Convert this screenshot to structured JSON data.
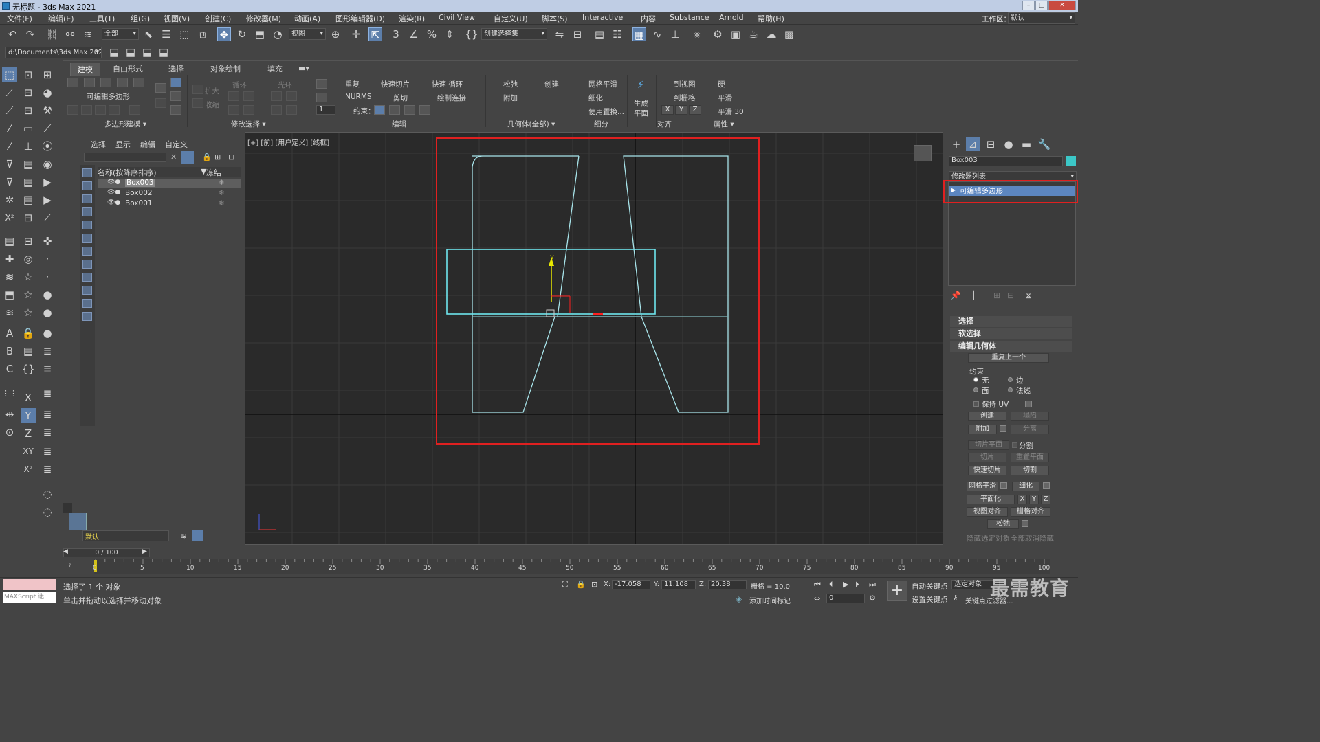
{
  "window": {
    "title": "无标题 - 3ds Max 2021",
    "controls": [
      "–",
      "□",
      "✕"
    ]
  },
  "menu": {
    "items": [
      "文件(F)",
      "编辑(E)",
      "工具(T)",
      "组(G)",
      "视图(V)",
      "创建(C)",
      "修改器(M)",
      "动画(A)",
      "图形编辑器(D)",
      "渲染(R)",
      "Civil View",
      "自定义(U)",
      "脚本(S)",
      "Interactive",
      "内容",
      "Substance",
      "Arnold",
      "帮助(H)"
    ],
    "workspace_label": "工作区：",
    "workspace_value": "默认"
  },
  "toolbar": {
    "selection_filter": "全部",
    "reference_coord": "视图",
    "named_selection": "创建选择集",
    "project_path": "d:\\Documents\\3ds Max 2021"
  },
  "ribbon": {
    "tabs": [
      "建模",
      "自由形式",
      "选择",
      "对象绘制",
      "填充"
    ],
    "panel_polymodeling_label": "可编辑多边形",
    "expand": "扩大",
    "shrink": "收缩",
    "loop": "循环",
    "ring": "光环",
    "repeat": "重复",
    "quickslice": "快速切片",
    "quickloop": "快速 循环",
    "nurms": "NURMS",
    "cut": "剪切",
    "paintconnect": "绘制连接",
    "constraints": "约束：",
    "relax": "松弛",
    "create": "创建",
    "attach": "附加",
    "meshsmooth": "网格平滑",
    "tessellate": "细化",
    "use_displace": "使用置换...",
    "generate": "生成",
    "plane": "平面",
    "to_view": "到视图",
    "to_grid": "到栅格",
    "hard": "硬",
    "smooth": "平滑",
    "smooth30": "平滑 30",
    "spin_value": "1",
    "footers": [
      "多边形建模 ▾",
      "修改选择 ▾",
      "编辑",
      "几何体(全部) ▾",
      "细分",
      "对齐",
      "属性 ▾"
    ]
  },
  "scene_explorer": {
    "tabs": [
      "选择",
      "显示",
      "编辑",
      "自定义"
    ],
    "col_name": "名称(按降序排序)",
    "col_freeze": "冻结",
    "objects": [
      {
        "name": "Box003",
        "selected": true
      },
      {
        "name": "Box002",
        "selected": false
      },
      {
        "name": "Box001",
        "selected": false
      }
    ],
    "layer": "默认"
  },
  "viewport": {
    "label": "[+] [前] [用户定义] [线框]",
    "gizmo_y": "y"
  },
  "command_panel": {
    "object_name": "Box003",
    "modifier_list": "修改器列表",
    "stack_item": "可编辑多边形",
    "rollouts": [
      "选择",
      "软选择",
      "编辑几何体"
    ],
    "repeat_last": "重复上一个",
    "constraints_label": "约束",
    "c_none": "无",
    "c_edge": "边",
    "c_face": "面",
    "c_normal": "法线",
    "preserve_uv": "保持 UV",
    "create": "创建",
    "collapse": "塌陷",
    "attach": "附加",
    "detach": "分离",
    "slice_plane": "切片平面",
    "split": "分割",
    "slice": "切片",
    "reset_plane": "重置平面",
    "quickslice": "快速切片",
    "cut": "切割",
    "meshsmooth": "网格平滑",
    "tessellate": "细化",
    "make_planar": "平面化",
    "xyz": [
      "X",
      "Y",
      "Z"
    ],
    "view_align": "视图对齐",
    "grid_align": "栅格对齐",
    "relax": "松弛",
    "hide_sel": "隐藏选定对象",
    "unhide_all": "全部取消隐藏"
  },
  "timeline": {
    "frame": "0 / 100",
    "ticks": [
      "0",
      "5",
      "10",
      "15",
      "20",
      "25",
      "30",
      "35",
      "40",
      "45",
      "50",
      "55",
      "60",
      "65",
      "70",
      "75",
      "80",
      "85",
      "90",
      "95",
      "100"
    ]
  },
  "status": {
    "maxscript": "MAXScript 迷",
    "selected": "选择了 1 个 对象",
    "prompt": "单击并拖动以选择并移动对象",
    "x_label": "X:",
    "x": "-17.058",
    "y_label": "Y:",
    "y": "11.108",
    "z_label": "Z:",
    "z": "20.38",
    "grid": "栅格 = 10.0",
    "add_time_tag": "添加时间标记",
    "auto_key": "自动关键点",
    "set_key": "设置关键点",
    "selected_obj": "选定对象",
    "key_filters": "关键点过滤器...",
    "frame_field": "0",
    "watermark": "最需教育"
  }
}
